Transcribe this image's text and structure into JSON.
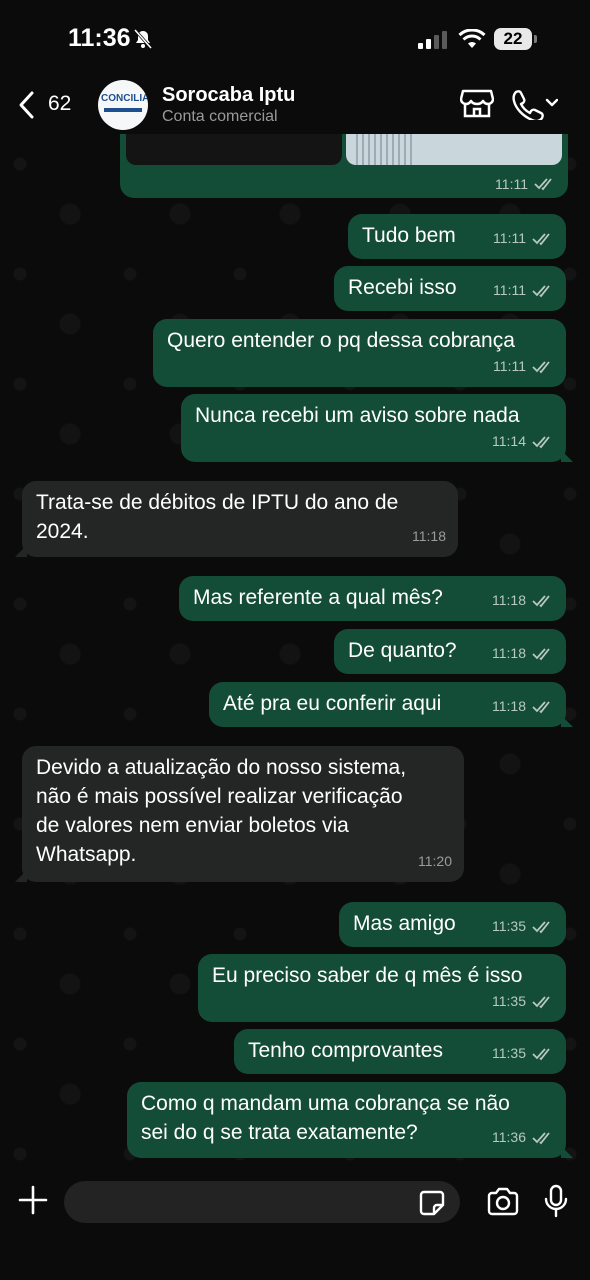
{
  "status_bar": {
    "time": "11:36",
    "battery": "22",
    "icons": [
      "bell-slash-icon",
      "signal-icon",
      "wifi-icon",
      "battery-icon"
    ]
  },
  "header": {
    "back_count": "62",
    "avatar_logo": "CONCILIA",
    "contact_name": "Sorocaba Iptu",
    "contact_subtitle": "Conta comercial",
    "icons": [
      "back-chevron-icon",
      "store-icon",
      "phone-icon",
      "chevron-down-icon"
    ]
  },
  "colors": {
    "background": "#0b0b0b",
    "outgoing_bubble": "#144d37",
    "incoming_bubble": "#242626",
    "time_text": "#b8c9c0"
  },
  "messages": [
    {
      "dir": "out",
      "type": "media",
      "time": "11:11"
    },
    {
      "dir": "out",
      "text": "Tudo bem",
      "time": "11:11"
    },
    {
      "dir": "out",
      "text": "Recebi isso",
      "time": "11:11"
    },
    {
      "dir": "out",
      "text": "Quero entender o pq dessa cobrança",
      "time": "11:11"
    },
    {
      "dir": "out",
      "text": "Nunca recebi um aviso sobre nada",
      "time": "11:14"
    },
    {
      "dir": "in",
      "text": "Trata-se de débitos de IPTU do ano de\n2024.",
      "time": "11:18"
    },
    {
      "dir": "out",
      "text": "Mas referente a qual mês?",
      "time": "11:18"
    },
    {
      "dir": "out",
      "text": "De quanto?",
      "time": "11:18"
    },
    {
      "dir": "out",
      "text": "Até pra eu conferir aqui",
      "time": "11:18"
    },
    {
      "dir": "in",
      "text": "Devido a atualização do nosso sistema,\nnão é mais possível realizar verificação\nde valores nem enviar boletos via\nWhatsapp.",
      "time": "11:20"
    },
    {
      "dir": "out",
      "text": "Mas amigo",
      "time": "11:35"
    },
    {
      "dir": "out",
      "text": "Eu preciso saber de q mês é isso",
      "time": "11:35"
    },
    {
      "dir": "out",
      "text": "Tenho comprovantes",
      "time": "11:35"
    },
    {
      "dir": "out",
      "text": "Como q mandam uma cobrança se não\nsei do q se trata exatamente?",
      "time": "11:36"
    }
  ],
  "composer": {
    "placeholder": "",
    "icons": [
      "plus-icon",
      "sticker-icon",
      "camera-icon",
      "microphone-icon"
    ]
  }
}
